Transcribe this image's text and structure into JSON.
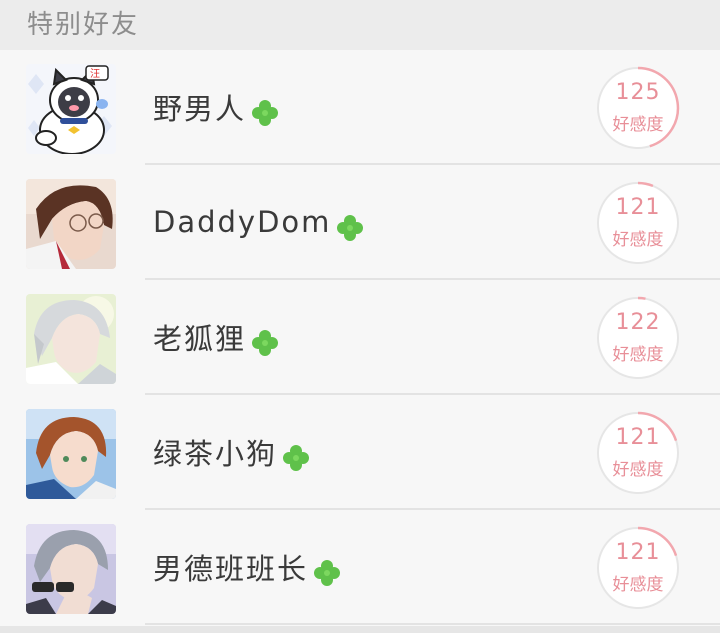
{
  "header": {
    "title": "特别好友"
  },
  "friends": [
    {
      "name": "野男人",
      "affinity": "125",
      "affinity_label": "好感度",
      "progress": 0.45,
      "avatar_icon": "cartoon-husky-avatar"
    },
    {
      "name": "DaddyDom",
      "affinity": "121",
      "affinity_label": "好感度",
      "progress": 0.06,
      "avatar_icon": "brown-hair-glasses-avatar"
    },
    {
      "name": "老狐狸",
      "affinity": "122",
      "affinity_label": "好感度",
      "progress": 0.03,
      "avatar_icon": "silver-hair-avatar"
    },
    {
      "name": "绿茶小狗",
      "affinity": "121",
      "affinity_label": "好感度",
      "progress": 0.2,
      "avatar_icon": "auburn-hair-avatar"
    },
    {
      "name": "男德班班长",
      "affinity": "121",
      "affinity_label": "好感度",
      "progress": 0.2,
      "avatar_icon": "gray-hair-sunglasses-avatar"
    }
  ],
  "colors": {
    "accent": "#e88f98",
    "ring_track": "#e6e6e6",
    "clover": "#5fc14a"
  }
}
